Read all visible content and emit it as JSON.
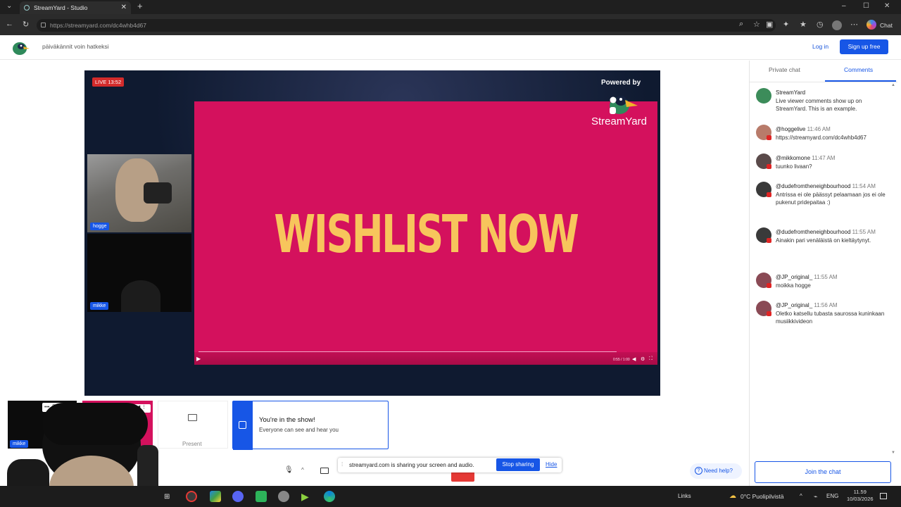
{
  "browser": {
    "tab_title": "StreamYard - Studio",
    "url": "https://streamyard.com/dc4whb4d67",
    "chat_label": "Chat"
  },
  "header": {
    "title": "päiväkännit voin hatkeksi",
    "login": "Log in",
    "signup": "Sign up free"
  },
  "stage": {
    "live_badge": "LIVE 13:52",
    "powered_by": "Powered by",
    "brand": "StreamYard",
    "video_text": "WISHLIST NOW",
    "video_time": "0:55 / 1:00",
    "video_progress": 0.92,
    "cams": [
      {
        "name": "hogge"
      },
      {
        "name": "mikke"
      }
    ]
  },
  "panel": {
    "tabs": [
      {
        "label": "Private chat"
      },
      {
        "label": "Comments",
        "active": true
      }
    ],
    "comments": [
      {
        "user": "StreamYard",
        "time": "",
        "text": "Live viewer comments show up on StreamYard. This is an example.",
        "color": "#3c8c5a"
      },
      {
        "user": "@hoggelive",
        "time": "11:46 AM",
        "text": "https://streamyard.com/dc4whb4d67",
        "color": "#b87b6a"
      },
      {
        "user": "@mikkomone",
        "time": "11:47 AM",
        "text": "tuunko livaan?",
        "color": "#5a4a4a"
      },
      {
        "user": "@dudefromtheneighbourhood",
        "time": "11:54 AM",
        "text": "Antrissa ei ole päässyt pelaamaan jos ei ole pukenut pridepaitaa :)",
        "color": "#3a3a3a"
      },
      {
        "user": "@dudefromtheneighbourhood",
        "time": "11:55 AM",
        "text": "Ainakin pari venäläistä on kieltäytynyt.",
        "color": "#3a3a3a"
      },
      {
        "user": "@JP_original_",
        "time": "11:55 AM",
        "text": "moikka hogge",
        "color": "#8a4a55"
      },
      {
        "user": "@JP_original_",
        "time": "11:56 AM",
        "text": "Oletko katsellu tubasta saurossa kuninkaan musiikkivideon",
        "color": "#8a4a55"
      }
    ],
    "join_chat": "Join the chat"
  },
  "bottom": {
    "present_label": "Present",
    "toast_title": "You're in the show!",
    "toast_sub": "Everyone can see and hear you",
    "share_text": "streamyard.com is sharing your screen and audio.",
    "stop_sharing": "Stop sharing",
    "hide": "Hide",
    "need_help": "Need help?",
    "thumb_name": "mikke"
  },
  "taskbar": {
    "links": "Links",
    "weather": "0°C  Puolipilvistä",
    "lang": "ENG",
    "time": "11.59",
    "date": "10/03/2026"
  }
}
